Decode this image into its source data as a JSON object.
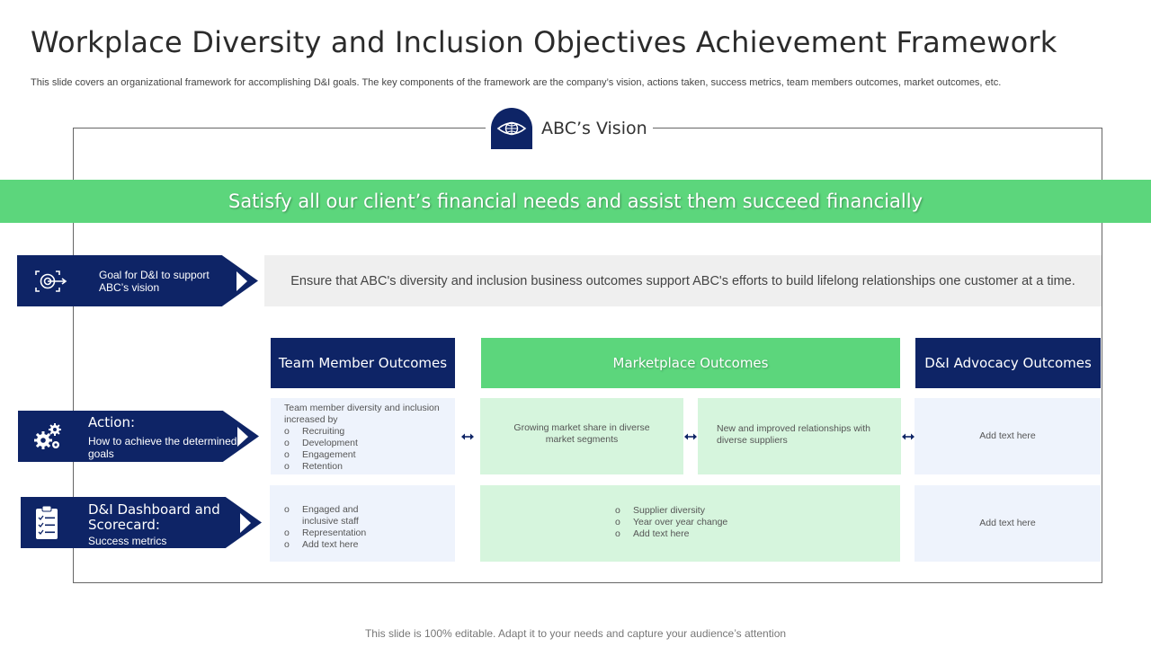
{
  "title": "Workplace Diversity and Inclusion Objectives Achievement Framework",
  "subtitle": "This slide covers an organizational framework for accomplishing D&I goals. The key components of the framework are the company’s vision, actions taken, success metrics, team members outcomes, market outcomes, etc.",
  "vision": {
    "label": "ABC’s Vision",
    "icon": "eye-globe-icon",
    "statement": "Satisfy all our client’s financial needs and assist them succeed financially"
  },
  "goal": {
    "label": "Goal for D&I to support ABC’s vision",
    "icon": "target-icon",
    "description": "Ensure that ABC's diversity and inclusion business outcomes support ABC's efforts to build lifelong relationships one customer at a time."
  },
  "action": {
    "title": "Action:",
    "subtitle": "How to achieve the determined goals",
    "icon": "gears-icon"
  },
  "dashboard": {
    "title": "D&I Dashboard and Scorecard:",
    "subtitle": "Success metrics",
    "icon": "clipboard-checklist-icon"
  },
  "columns": {
    "team": "Team Member Outcomes",
    "market": "Marketplace Outcomes",
    "dni": "D&I Advocacy Outcomes"
  },
  "team_action": {
    "intro": "Team member diversity and inclusion increased by",
    "items": [
      "Recruiting",
      "Development",
      "Engagement",
      "Retention"
    ]
  },
  "market_action_1": "Growing market share in diverse market segments",
  "market_action_2": "New and improved relationships with diverse suppliers",
  "dni_action": "Add text here",
  "team_metrics": [
    "Engaged and inclusive staff",
    "Representation",
    " Add text here"
  ],
  "market_metrics": [
    "Supplier diversity",
    "Year over year change",
    " Add text here"
  ],
  "dni_metrics": "Add text here",
  "footer": "This slide is 100% editable. Adapt it to your needs and capture your audience’s attention",
  "colors": {
    "navy": "#0e2466",
    "green": "#5cd67c",
    "light_green": "#d6f5dd",
    "light_blue": "#eef3fc",
    "grey": "#efefef"
  }
}
